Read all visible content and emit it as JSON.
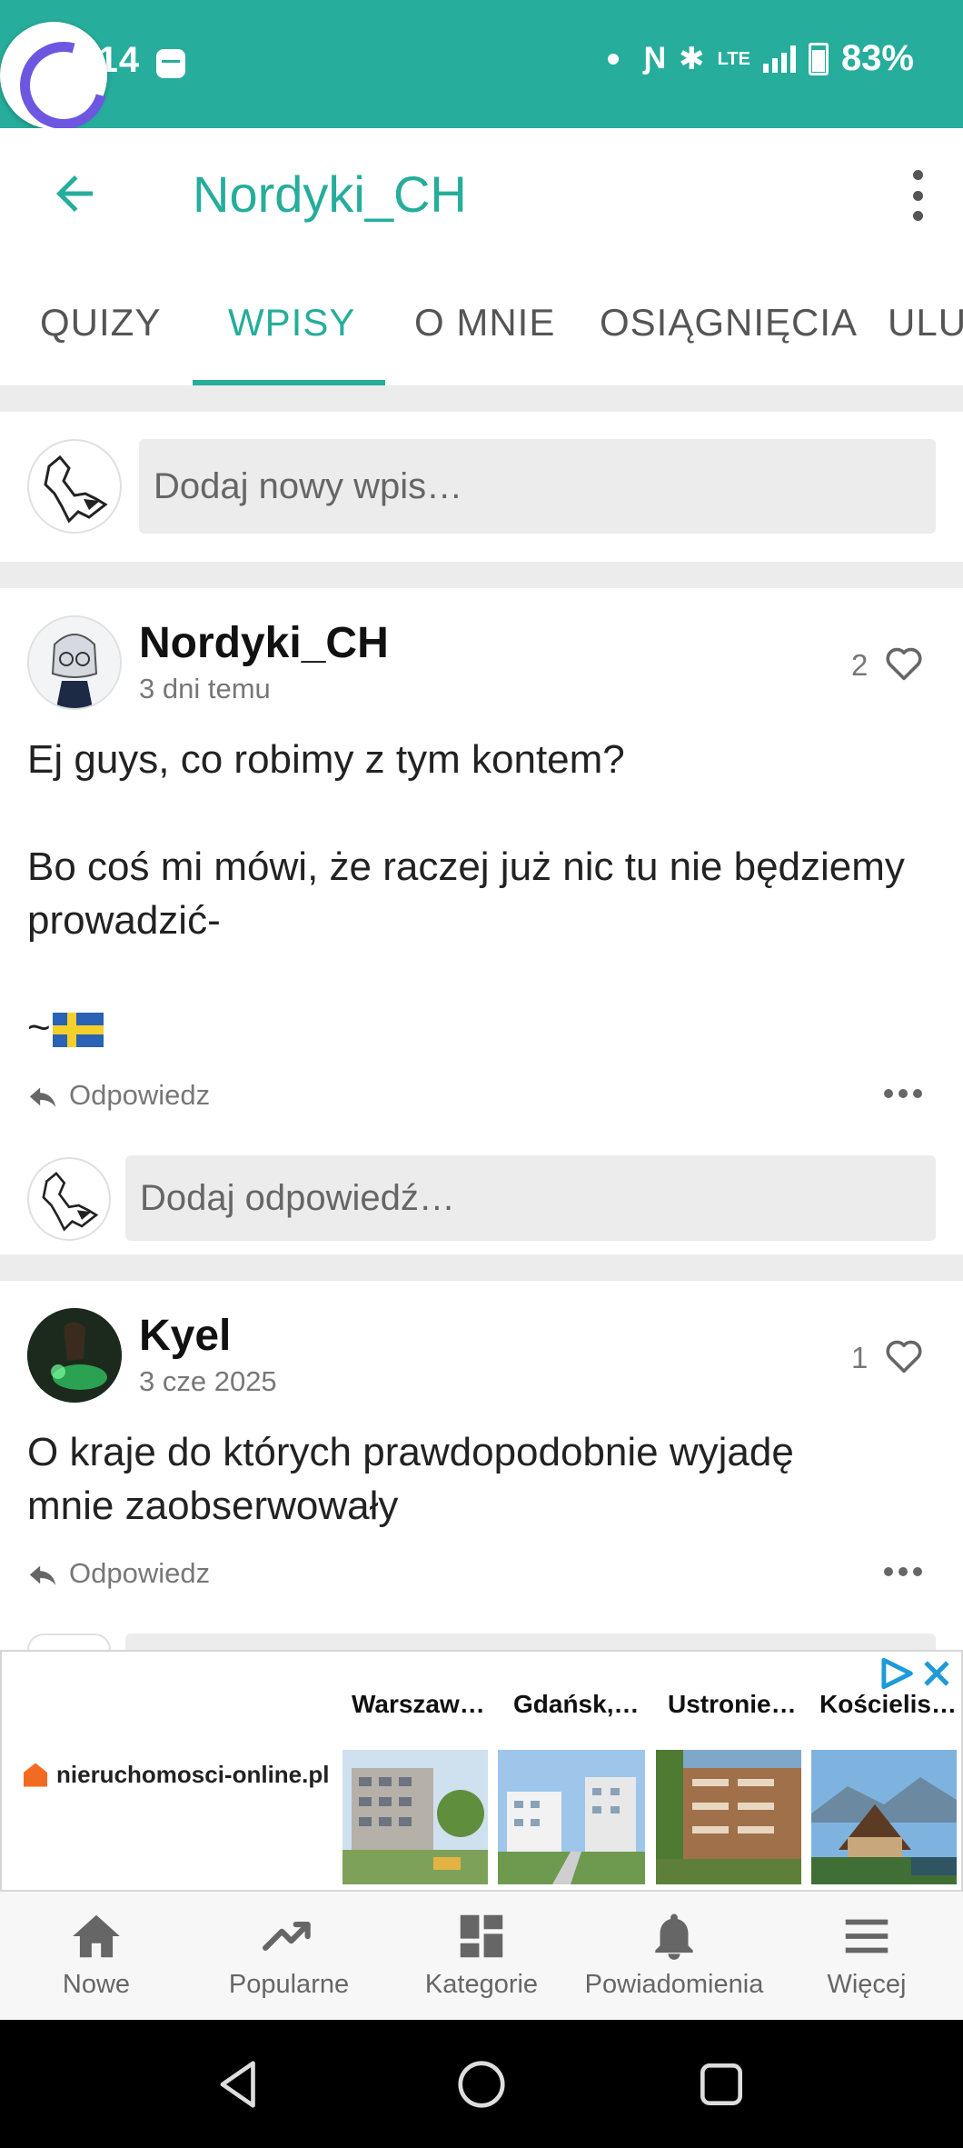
{
  "status_bar": {
    "time": "5:14",
    "battery": "83%",
    "network": "LTE"
  },
  "header": {
    "title": "Nordyki_CH",
    "back_icon": "arrow-left-icon",
    "menu_icon": "more-vertical-icon"
  },
  "tabs": [
    {
      "label": "QUIZY"
    },
    {
      "label": "WPISY",
      "active": true
    },
    {
      "label": "O MNIE"
    },
    {
      "label": "OSIĄGNIĘCIA"
    },
    {
      "label": "ULUBIONE"
    }
  ],
  "new_post": {
    "placeholder": "Dodaj nowy wpis…"
  },
  "posts": [
    {
      "author": "Nordyki_CH",
      "time": "3 dni temu",
      "likes": "2",
      "body_line1": "Ej guys, co robimy z tym kontem?",
      "body_line2": "Bo coś mi mówi, że raczej już nic tu nie będziemy prowadzić-",
      "body_line3": "~",
      "reply_label": "Odpowiedz",
      "reply_placeholder": "Dodaj odpowiedź…"
    },
    {
      "author": "Kyel",
      "time": "3 cze 2025",
      "likes": "1",
      "body_line1": "O kraje do których prawdopodobnie wyjadę mnie zaobserwowały",
      "reply_label": "Odpowiedz"
    }
  ],
  "ad": {
    "brand": "nieruchomosci-online.pl",
    "cards": [
      {
        "title": "Warszaw…"
      },
      {
        "title": "Gdańsk,…"
      },
      {
        "title": "Ustronie…"
      },
      {
        "title": "Kościelis…"
      }
    ]
  },
  "bottom_nav": [
    {
      "label": "Nowe",
      "icon": "home-icon"
    },
    {
      "label": "Popularne",
      "icon": "trending-icon"
    },
    {
      "label": "Kategorie",
      "icon": "dashboard-icon"
    },
    {
      "label": "Powiadomienia",
      "icon": "bell-icon"
    },
    {
      "label": "Więcej",
      "icon": "hamburger-icon"
    }
  ],
  "colors": {
    "accent": "#26ad9b",
    "divider": "#ececec"
  }
}
